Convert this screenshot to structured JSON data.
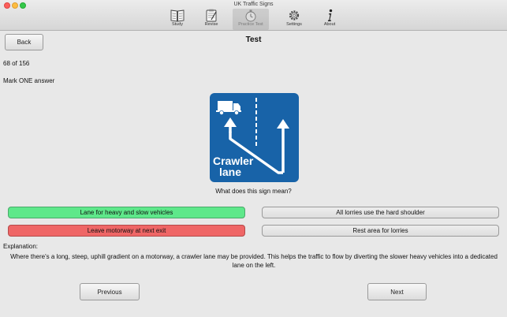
{
  "window": {
    "title": "UK Traffic Signs"
  },
  "toolbar": {
    "items": [
      {
        "label": "Study",
        "icon": "book-icon"
      },
      {
        "label": "Revise",
        "icon": "clipboard-icon"
      },
      {
        "label": "Practice Test",
        "icon": "stopwatch-icon",
        "active": true
      },
      {
        "label": "Settings",
        "icon": "gear-icon"
      },
      {
        "label": "About",
        "icon": "info-icon"
      }
    ]
  },
  "page": {
    "back_label": "Back",
    "title": "Test",
    "progress": "68 of 156",
    "instruction": "Mark ONE answer"
  },
  "question": {
    "sign_text_line1": "Crawler",
    "sign_text_line2": "lane",
    "sign_color": "#1863a8",
    "text": "What does this sign mean?"
  },
  "answers": [
    {
      "label": "Lane for heavy and slow vehicles",
      "state": "correct"
    },
    {
      "label": "All lorries use the hard shoulder",
      "state": "neutral"
    },
    {
      "label": "Leave motorway at next exit",
      "state": "wrong"
    },
    {
      "label": "Rest area for lorries",
      "state": "neutral"
    }
  ],
  "explanation": {
    "heading": "Explanation:",
    "text": "Where there's a long, steep, uphill gradient on a motorway, a crawler lane may be provided. This helps the traffic to flow by diverting the slower heavy vehicles into a dedicated lane on the left."
  },
  "navigation": {
    "previous_label": "Previous",
    "next_label": "Next"
  },
  "colors": {
    "correct": "#5ee88a",
    "wrong": "#ef6666"
  }
}
